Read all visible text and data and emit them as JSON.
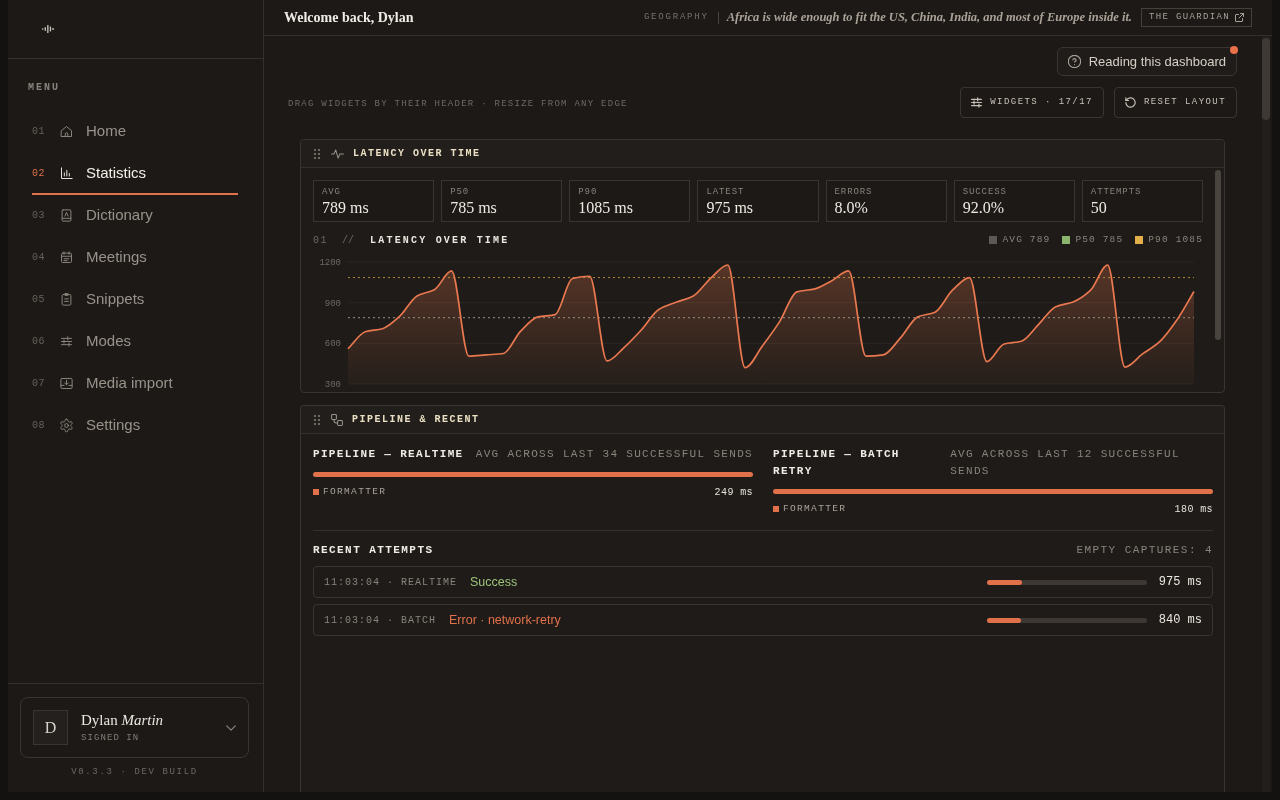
{
  "sidebar": {
    "menu_heading": "MENU",
    "items": [
      {
        "number": "01",
        "label": "Home",
        "selected": false
      },
      {
        "number": "02",
        "label": "Statistics",
        "selected": true
      },
      {
        "number": "03",
        "label": "Dictionary",
        "selected": false
      },
      {
        "number": "04",
        "label": "Meetings",
        "selected": false
      },
      {
        "number": "05",
        "label": "Snippets",
        "selected": false
      },
      {
        "number": "06",
        "label": "Modes",
        "selected": false
      },
      {
        "number": "07",
        "label": "Media import",
        "selected": false
      },
      {
        "number": "08",
        "label": "Settings",
        "selected": false
      }
    ],
    "user": {
      "avatar": "D",
      "name": "Dylan *Martin*",
      "status": "SIGNED IN"
    },
    "version": "V0.3.3 · DEV BUILD"
  },
  "header": {
    "greeting": "Welcome back, Dylan",
    "fact_topic": "GEOGRAPHY",
    "fact": "Africa is wide enough to fit the US, China, India, and most of Europe inside it.",
    "source_link": "THE GUARDIAN"
  },
  "toolbar": {
    "help_button": {
      "label": "Reading this dashboard",
      "notification": true
    },
    "hint": "DRAG WIDGETS BY THEIR HEADER · RESIZE FROM ANY EDGE",
    "buttons": [
      {
        "kind": "widgets",
        "label": "WIDGETS · 17/17"
      },
      {
        "kind": "reset",
        "label": "RESET LAYOUT"
      }
    ]
  },
  "widgets": [
    {
      "kind": "latency",
      "title": "LATENCY OVER TIME",
      "stats": [
        {
          "label": "AVG",
          "value": "789 ms"
        },
        {
          "label": "P50",
          "value": "785 ms"
        },
        {
          "label": "P90",
          "value": "1085 ms"
        },
        {
          "label": "LATEST",
          "value": "975 ms"
        },
        {
          "label": "ERRORS",
          "value": "8.0%"
        },
        {
          "label": "SUCCESS",
          "value": "92.0%"
        },
        {
          "label": "ATTEMPTS",
          "value": "50"
        }
      ],
      "chart": {
        "number": "01",
        "separator": "//",
        "title": "LATENCY OVER TIME",
        "legend": [
          {
            "label": "AVG 789",
            "color": "#5e5954"
          },
          {
            "label": "P50 785",
            "color": "#8ab56c"
          },
          {
            "label": "P90 1085",
            "color": "#e2b04c"
          }
        ],
        "chart_data": {
          "type": "area",
          "series": [
            {
              "color": "#e8784f",
              "values": [
                560,
                685,
                708,
                800,
                950,
                995,
                1134,
                505,
                515,
                525,
                690,
                795,
                812,
                1078,
                1095,
                470,
                570,
                700,
                850,
                903,
                950,
                1080,
                1178,
                420,
                580,
                760,
                980,
                1000,
                1060,
                1134,
                505,
                515,
                640,
                795,
                830,
                990,
                1085,
                465,
                595,
                615,
                740,
                870,
                905,
                990,
                1178,
                425,
                520,
                610,
                770,
                982
              ]
            }
          ],
          "ylim": [
            300,
            1200
          ],
          "yticks": [
            300,
            600,
            900,
            1200
          ],
          "ref_lines": [
            {
              "axis": "y",
              "value": 1085,
              "color": "#b48a3c"
            },
            {
              "axis": "y",
              "value": 789,
              "color": "#9a948e"
            }
          ]
        }
      }
    },
    {
      "kind": "pipeline",
      "title": "PIPELINE & RECENT",
      "pipelines": [
        {
          "title": "PIPELINE — REALTIME",
          "subtitle": "AVG ACROSS LAST 34 SUCCESSFUL SENDS",
          "stages": [
            {
              "name": "FORMATTER",
              "duration": "249 ms",
              "level": 1,
              "color": "#e0714a"
            }
          ]
        },
        {
          "title": "PIPELINE — BATCH RETRY",
          "subtitle": "AVG ACROSS LAST 12 SUCCESSFUL SENDS",
          "stages": [
            {
              "name": "FORMATTER",
              "duration": "180 ms",
              "level": 1,
              "color": "#e0714a"
            }
          ]
        }
      ],
      "recent": {
        "title": "RECENT ATTEMPTS",
        "summary": "EMPTY CAPTURES: 4",
        "attempts": [
          {
            "meta": "11:03:04 · REALTIME",
            "status": "Success",
            "kind": "success",
            "duration": "975 ms",
            "level": 0.22
          },
          {
            "meta": "11:03:04 · BATCH",
            "status": "Error · network-retry",
            "kind": "error",
            "duration": "840 ms",
            "level": 0.21
          }
        ]
      }
    }
  ]
}
